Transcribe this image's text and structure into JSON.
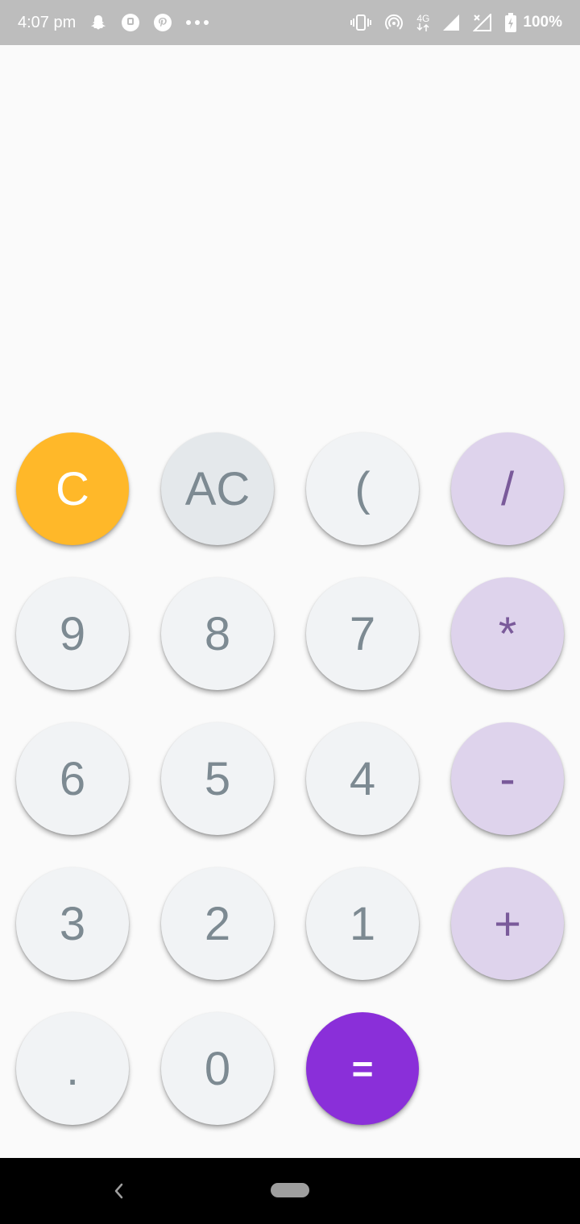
{
  "status_bar": {
    "time": "4:07 pm",
    "battery": "100%",
    "network": "4G",
    "left_icons": [
      "snapchat-icon",
      "pocket-icon",
      "pinterest-icon",
      "more-dots-icon"
    ],
    "right_icons": [
      "vibrate-icon",
      "hotspot-icon",
      "network-4g-icon",
      "signal-icon",
      "signal-no-data-icon",
      "battery-charging-icon"
    ]
  },
  "display": {
    "expression": "",
    "result": ""
  },
  "keypad": {
    "row1": {
      "clear": "C",
      "all_clear": "AC",
      "paren": "(",
      "divide": "/"
    },
    "row2": {
      "nine": "9",
      "eight": "8",
      "seven": "7",
      "multiply": "*"
    },
    "row3": {
      "six": "6",
      "five": "5",
      "four": "4",
      "minus": "-"
    },
    "row4": {
      "three": "3",
      "two": "2",
      "one": "1",
      "plus": "+"
    },
    "row5": {
      "dot": ".",
      "zero": "0",
      "equals": "="
    }
  },
  "colors": {
    "clear": "#ffb829",
    "all_clear": "#e4e8eb",
    "number": "#f1f3f5",
    "operator": "#ded3ec",
    "equals": "#8a2fd9",
    "status_bar": "#bdbdbd"
  },
  "nav_bar": {
    "icons": [
      "back-icon",
      "home-pill-icon"
    ]
  }
}
